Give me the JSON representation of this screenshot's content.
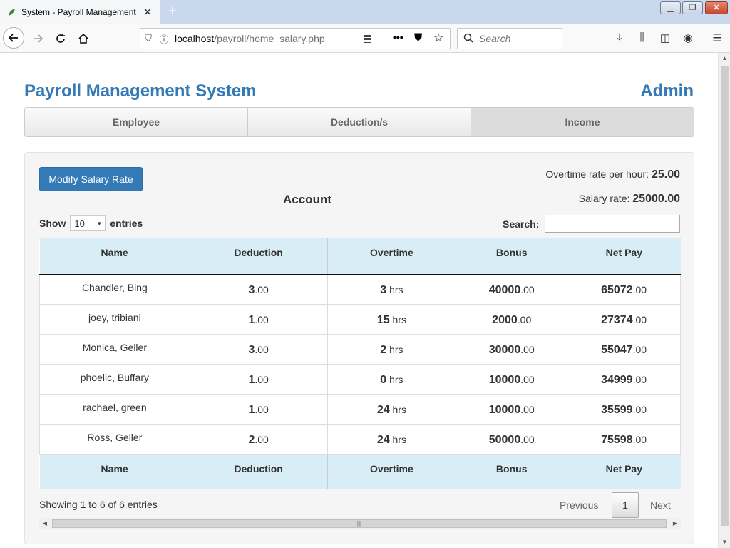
{
  "browser": {
    "tab_title": "System - Payroll Management",
    "tab_close": "✕",
    "new_tab": "+",
    "url_host": "localhost",
    "url_path": "/payroll/home_salary.php",
    "search_placeholder": "Search"
  },
  "header": {
    "brand": "Payroll Management System",
    "user": "Admin"
  },
  "menu": [
    "Employee",
    "Deduction/s",
    "Income"
  ],
  "panel": {
    "modify_button": "Modify Salary Rate",
    "overtime_label": "Overtime rate per hour:",
    "overtime_value": "25.00",
    "salary_label": "Salary rate:",
    "salary_value": "25000.00",
    "account_title": "Account",
    "show_label": "Show",
    "entries_value": "10",
    "entries_label": "entries",
    "search_label": "Search:"
  },
  "table": {
    "columns": [
      "Name",
      "Deduction",
      "Overtime",
      "Bonus",
      "Net Pay"
    ],
    "rows": [
      {
        "name": "Chandler, Bing",
        "deduction_int": "3",
        "deduction_dec": ".00",
        "overtime": "3",
        "overtime_unit": " hrs",
        "bonus_int": "40000",
        "bonus_dec": ".00",
        "net_int": "65072",
        "net_dec": ".00"
      },
      {
        "name": "joey, tribiani",
        "deduction_int": "1",
        "deduction_dec": ".00",
        "overtime": "15",
        "overtime_unit": " hrs",
        "bonus_int": "2000",
        "bonus_dec": ".00",
        "net_int": "27374",
        "net_dec": ".00"
      },
      {
        "name": "Monica, Geller",
        "deduction_int": "3",
        "deduction_dec": ".00",
        "overtime": "2",
        "overtime_unit": " hrs",
        "bonus_int": "30000",
        "bonus_dec": ".00",
        "net_int": "55047",
        "net_dec": ".00"
      },
      {
        "name": "phoelic, Buffary",
        "deduction_int": "1",
        "deduction_dec": ".00",
        "overtime": "0",
        "overtime_unit": " hrs",
        "bonus_int": "10000",
        "bonus_dec": ".00",
        "net_int": "34999",
        "net_dec": ".00"
      },
      {
        "name": "rachael, green",
        "deduction_int": "1",
        "deduction_dec": ".00",
        "overtime": "24",
        "overtime_unit": " hrs",
        "bonus_int": "10000",
        "bonus_dec": ".00",
        "net_int": "35599",
        "net_dec": ".00"
      },
      {
        "name": "Ross, Geller",
        "deduction_int": "2",
        "deduction_dec": ".00",
        "overtime": "24",
        "overtime_unit": " hrs",
        "bonus_int": "50000",
        "bonus_dec": ".00",
        "net_int": "75598",
        "net_dec": ".00"
      }
    ]
  },
  "footer": {
    "info": "Showing 1 to 6 of 6 entries",
    "previous": "Previous",
    "page": "1",
    "next": "Next"
  },
  "colors": {
    "brand": "#337ab7",
    "header_bg": "#d9edf7",
    "panel_bg": "#f5f5f5"
  }
}
